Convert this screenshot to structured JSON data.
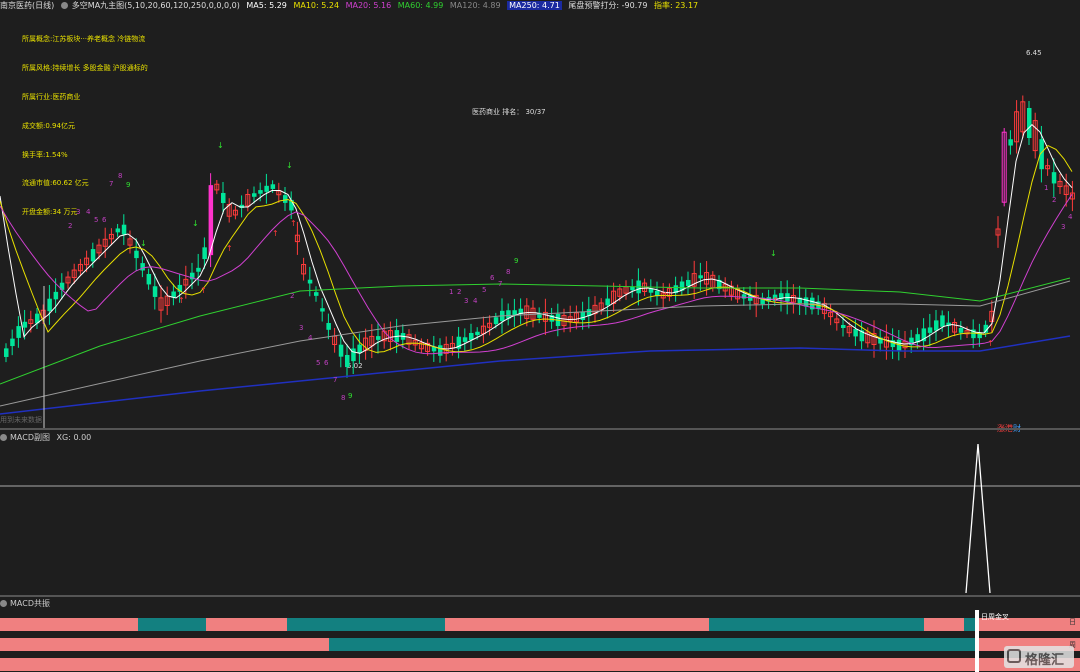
{
  "header": {
    "stock_name": "南京医药(日线)",
    "indicator_name": "多空MA九主图(5,10,20,60,120,250,0,0,0,0)",
    "ma5": "MA5: 5.29",
    "ma10": "MA10: 5.24",
    "ma20": "MA20: 5.16",
    "ma60": "MA60: 4.99",
    "ma120": "MA120: 4.89",
    "ma250": "MA250: 4.71",
    "score": "尾盘预警打分: -90.79",
    "index_value": "指率: 23.17"
  },
  "info_lines": [
    "所属概念:江苏板块···养老概念 冷链物流",
    "所属风格:持续增长 多股金融 沪股通标的",
    "所属行业:医药商业",
    "成交额:0.94亿元",
    "换手率:1.54%",
    "流通市值:60.62 亿元",
    "开盘金额:34 万元"
  ],
  "industry_rank": "医药商业 排名： 30/37",
  "price_labels": {
    "high": "6.45",
    "low": "5.02"
  },
  "future_data_label": "用到未来数据",
  "zhang_label": "涨",
  "gang_label": "港",
  "cai_label": "财",
  "macd_sub": {
    "title": "MACD副图",
    "xg": "XG: 0.00"
  },
  "resonance": {
    "title": "MACD共振",
    "annotation": "日周金叉",
    "right_a": "日",
    "right_b": "周"
  },
  "watermark": "格隆汇",
  "colors": {
    "up": "#ff3b3b",
    "down": "#00e59a",
    "strong": "#ff33cc",
    "pink_bar": "#f08080",
    "teal_bar": "#138080"
  }
}
